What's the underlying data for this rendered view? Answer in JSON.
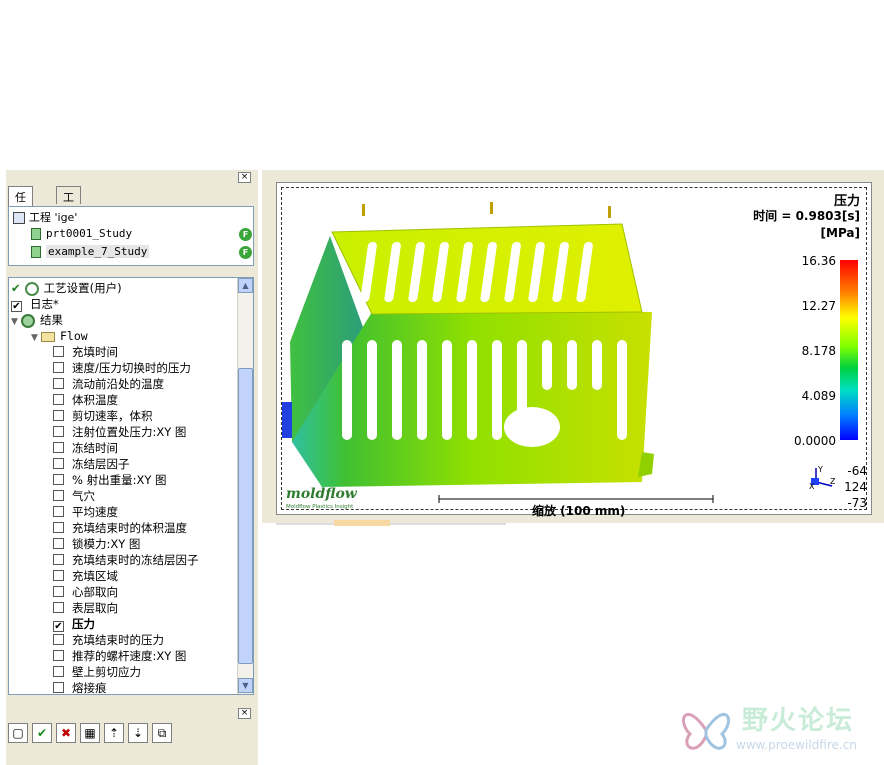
{
  "left_panel": {
    "close_label": "×",
    "tabs": [
      {
        "label": "任务"
      },
      {
        "label": "工具"
      }
    ],
    "project": {
      "name": "工程 'ige'",
      "studies": [
        {
          "name": "prt0001_Study",
          "badge": "F"
        },
        {
          "name": "example_7_Study",
          "badge": "F"
        }
      ]
    },
    "tree": {
      "settings": "工艺设置(用户)",
      "log": "日志*",
      "results": "结果",
      "flow_folder": "Flow",
      "items": [
        {
          "label": "充填时间",
          "checked": false
        },
        {
          "label": "速度/压力切换时的压力",
          "checked": false
        },
        {
          "label": "流动前沿处的温度",
          "checked": false
        },
        {
          "label": "体积温度",
          "checked": false
        },
        {
          "label": "剪切速率，体积",
          "checked": false
        },
        {
          "label": "注射位置处压力:XY 图",
          "checked": false
        },
        {
          "label": "冻结时间",
          "checked": false
        },
        {
          "label": "冻结层因子",
          "checked": false
        },
        {
          "label": "% 射出重量:XY 图",
          "checked": false
        },
        {
          "label": "气穴",
          "checked": false
        },
        {
          "label": "平均速度",
          "checked": false
        },
        {
          "label": "充填结束时的体积温度",
          "checked": false
        },
        {
          "label": "锁模力:XY 图",
          "checked": false
        },
        {
          "label": "充填结束时的冻结层因子",
          "checked": false
        },
        {
          "label": "充填区域",
          "checked": false
        },
        {
          "label": "心部取向",
          "checked": false
        },
        {
          "label": "表层取向",
          "checked": false
        },
        {
          "label": "压力",
          "checked": true
        },
        {
          "label": "充填结束时的压力",
          "checked": false
        },
        {
          "label": "推荐的螺杆速度:XY 图",
          "checked": false
        },
        {
          "label": "壁上剪切应力",
          "checked": false
        },
        {
          "label": "熔接痕",
          "checked": false
        }
      ]
    },
    "toolbar": [
      "new-icon",
      "check-icon",
      "delete-icon",
      "properties-icon",
      "move-up-icon",
      "move-down-icon",
      "copy-icon"
    ]
  },
  "viewer": {
    "result_title": "压力",
    "time_label": "时间 = 0.9803[s]",
    "unit_label": "[MPa]",
    "scale_ticks": [
      "16.36",
      "12.27",
      "8.178",
      "4.089",
      "0.0000"
    ],
    "scale_label": "缩放 (100 mm)",
    "orientation": [
      "-64",
      "124",
      "-73"
    ],
    "axis_letters": {
      "x": "X",
      "y": "Y",
      "z": "Z"
    },
    "logo_text": "moldflow",
    "logo_sub": "Moldflow Plastics Insight",
    "colors": {
      "max": "#ff0000",
      "mid": "#00d040",
      "min": "#0000ff",
      "part": "#c8e000"
    }
  },
  "watermark": {
    "title": "野火论坛",
    "url": "www.proewildfire.cn"
  }
}
